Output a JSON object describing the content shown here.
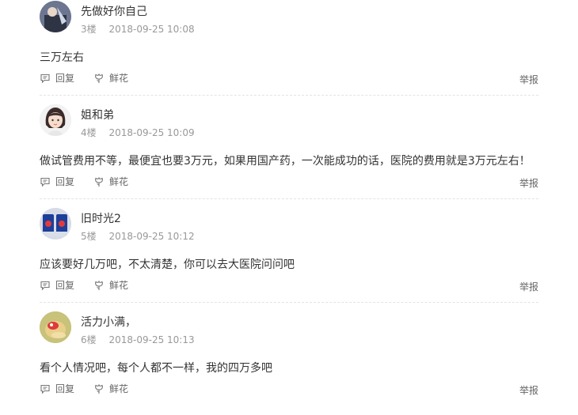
{
  "posts": [
    {
      "avatar_icon": "user-avatar-photo-icon",
      "username": "先做好你自己",
      "floor": "3楼",
      "timestamp": "2018-09-25 10:08",
      "content": "三万左右",
      "reply_label": "回复",
      "flower_label": "鲜花",
      "report_label": "举报"
    },
    {
      "avatar_icon": "user-avatar-cartoon-girl-icon",
      "username": "姐和弟",
      "floor": "4楼",
      "timestamp": "2018-09-25 10:09",
      "content": "做试管费用不等，最便宜也要3万元，如果用国产药，一次能成功的话，医院的费用就是3万元左右！",
      "reply_label": "回复",
      "flower_label": "鲜花",
      "report_label": "举报"
    },
    {
      "avatar_icon": "user-avatar-photo-icon",
      "username": "旧时光2",
      "floor": "5楼",
      "timestamp": "2018-09-25 10:12",
      "content": "应该要好几万吧，不太清楚，你可以去大医院问问吧",
      "reply_label": "回复",
      "flower_label": "鲜花",
      "report_label": "举报"
    },
    {
      "avatar_icon": "user-avatar-photo-icon",
      "username": "活力小满，",
      "floor": "6楼",
      "timestamp": "2018-09-25 10:13",
      "content": "看个人情况吧，每个人都不一样，我的四万多吧",
      "reply_label": "回复",
      "flower_label": "鲜花",
      "report_label": "举报"
    }
  ],
  "icons": {
    "reply": "reply-bubble-icon",
    "flower": "flower-icon"
  },
  "colors": {
    "text": "#333333",
    "meta": "#999999",
    "action": "#666666",
    "divider": "#e3e3e3"
  }
}
